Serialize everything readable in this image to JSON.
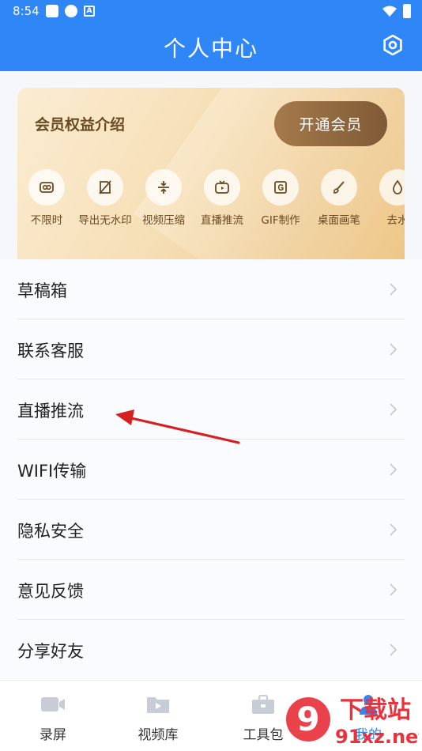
{
  "status_bar": {
    "time": "8:54"
  },
  "header": {
    "title": "个人中心"
  },
  "member_card": {
    "title": "会员权益介绍",
    "open_button": "开通会员",
    "features": [
      {
        "label": "不限时",
        "icon": "infinity-icon"
      },
      {
        "label": "导出无水印",
        "icon": "no-watermark-icon"
      },
      {
        "label": "视频压缩",
        "icon": "compress-icon"
      },
      {
        "label": "直播推流",
        "icon": "tv-play-icon"
      },
      {
        "label": "GIF制作",
        "icon": "gif-icon"
      },
      {
        "label": "桌面画笔",
        "icon": "brush-icon"
      },
      {
        "label": "去水",
        "icon": "water-drop-icon"
      }
    ]
  },
  "menu": [
    {
      "label": "草稿箱"
    },
    {
      "label": "联系客服"
    },
    {
      "label": "直播推流"
    },
    {
      "label": "WIFI传输"
    },
    {
      "label": "隐私安全"
    },
    {
      "label": "意见反馈"
    },
    {
      "label": "分享好友"
    }
  ],
  "bottom_nav": [
    {
      "label": "录屏",
      "icon": "video-camera-icon"
    },
    {
      "label": "视频库",
      "icon": "video-folder-icon"
    },
    {
      "label": "工具包",
      "icon": "toolbox-icon"
    },
    {
      "label": "我的",
      "icon": "user-icon"
    }
  ],
  "watermark": {
    "text": "下载站",
    "domain": "91xz.net",
    "mark": "9"
  },
  "colors": {
    "primary": "#2f86f6",
    "gold_text": "#6a4a22",
    "vip_button": "#8f6840",
    "annotation": "#d62020"
  }
}
